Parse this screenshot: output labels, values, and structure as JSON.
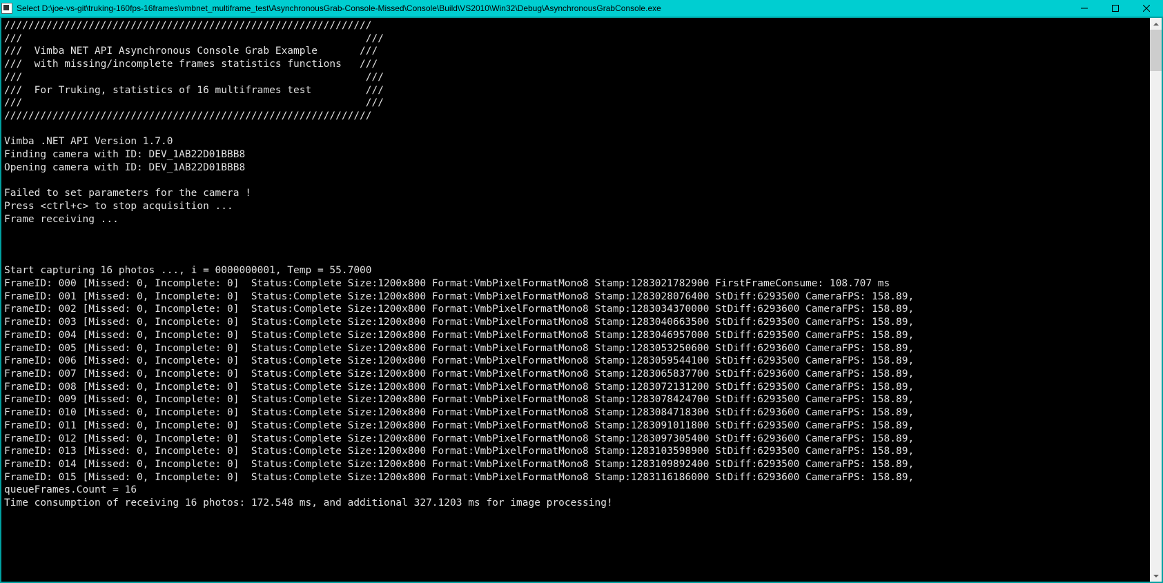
{
  "window": {
    "title": "Select D:\\joe-vs-git\\truking-160fps-16frames\\vmbnet_multiframe_test\\AsynchronousGrab-Console-Missed\\Console\\Build\\VS2010\\Win32\\Debug\\AsynchronousGrabConsole.exe"
  },
  "header": {
    "line1": "/////////////////////////////////////////////////////////////",
    "line2": "///                                                         ///",
    "line3": "///  Vimba NET API Asynchronous Console Grab Example       ///",
    "line4": "///  with missing/incomplete frames statistics functions   ///",
    "line5": "///                                                         ///",
    "line6": "///  For Truking, statistics of 16 multiframes test         ///",
    "line7": "///                                                         ///",
    "line8": "/////////////////////////////////////////////////////////////"
  },
  "info": {
    "api_version": "Vimba .NET API Version 1.7.0",
    "finding": "Finding camera with ID: DEV_1AB22D01BBB8",
    "opening": "Opening camera with ID: DEV_1AB22D01BBB8",
    "failed": "Failed to set parameters for the camera !",
    "press": "Press <ctrl+c> to stop acquisition ...",
    "receiving": "Frame receiving ..."
  },
  "capture": {
    "start": "Start capturing 16 photos ..., i = 0000000001, Temp = 55.7000"
  },
  "frames": [
    "FrameID: 000 [Missed: 0, Incomplete: 0]  Status:Complete Size:1200x800 Format:VmbPixelFormatMono8 Stamp:1283021782900 FirstFrameConsume: 108.707 ms",
    "FrameID: 001 [Missed: 0, Incomplete: 0]  Status:Complete Size:1200x800 Format:VmbPixelFormatMono8 Stamp:1283028076400 StDiff:6293500 CameraFPS: 158.89,",
    "FrameID: 002 [Missed: 0, Incomplete: 0]  Status:Complete Size:1200x800 Format:VmbPixelFormatMono8 Stamp:1283034370000 StDiff:6293600 CameraFPS: 158.89,",
    "FrameID: 003 [Missed: 0, Incomplete: 0]  Status:Complete Size:1200x800 Format:VmbPixelFormatMono8 Stamp:1283040663500 StDiff:6293500 CameraFPS: 158.89,",
    "FrameID: 004 [Missed: 0, Incomplete: 0]  Status:Complete Size:1200x800 Format:VmbPixelFormatMono8 Stamp:1283046957000 StDiff:6293500 CameraFPS: 158.89,",
    "FrameID: 005 [Missed: 0, Incomplete: 0]  Status:Complete Size:1200x800 Format:VmbPixelFormatMono8 Stamp:1283053250600 StDiff:6293600 CameraFPS: 158.89,",
    "FrameID: 006 [Missed: 0, Incomplete: 0]  Status:Complete Size:1200x800 Format:VmbPixelFormatMono8 Stamp:1283059544100 StDiff:6293500 CameraFPS: 158.89,",
    "FrameID: 007 [Missed: 0, Incomplete: 0]  Status:Complete Size:1200x800 Format:VmbPixelFormatMono8 Stamp:1283065837700 StDiff:6293600 CameraFPS: 158.89,",
    "FrameID: 008 [Missed: 0, Incomplete: 0]  Status:Complete Size:1200x800 Format:VmbPixelFormatMono8 Stamp:1283072131200 StDiff:6293500 CameraFPS: 158.89,",
    "FrameID: 009 [Missed: 0, Incomplete: 0]  Status:Complete Size:1200x800 Format:VmbPixelFormatMono8 Stamp:1283078424700 StDiff:6293500 CameraFPS: 158.89,",
    "FrameID: 010 [Missed: 0, Incomplete: 0]  Status:Complete Size:1200x800 Format:VmbPixelFormatMono8 Stamp:1283084718300 StDiff:6293600 CameraFPS: 158.89,",
    "FrameID: 011 [Missed: 0, Incomplete: 0]  Status:Complete Size:1200x800 Format:VmbPixelFormatMono8 Stamp:1283091011800 StDiff:6293500 CameraFPS: 158.89,",
    "FrameID: 012 [Missed: 0, Incomplete: 0]  Status:Complete Size:1200x800 Format:VmbPixelFormatMono8 Stamp:1283097305400 StDiff:6293600 CameraFPS: 158.89,",
    "FrameID: 013 [Missed: 0, Incomplete: 0]  Status:Complete Size:1200x800 Format:VmbPixelFormatMono8 Stamp:1283103598900 StDiff:6293500 CameraFPS: 158.89,",
    "FrameID: 014 [Missed: 0, Incomplete: 0]  Status:Complete Size:1200x800 Format:VmbPixelFormatMono8 Stamp:1283109892400 StDiff:6293500 CameraFPS: 158.89,",
    "FrameID: 015 [Missed: 0, Incomplete: 0]  Status:Complete Size:1200x800 Format:VmbPixelFormatMono8 Stamp:1283116186000 StDiff:6293600 CameraFPS: 158.89,"
  ],
  "footer": {
    "queue": "queueFrames.Count = 16",
    "time": "Time consumption of receiving 16 photos: 172.548 ms, and additional 327.1203 ms for image processing!"
  }
}
